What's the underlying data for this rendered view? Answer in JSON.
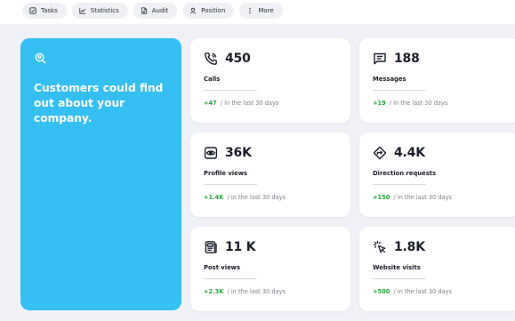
{
  "nav": {
    "tabs": [
      {
        "label": "Tasks",
        "icon": "checkbox-icon"
      },
      {
        "label": "Statistics",
        "icon": "chart-icon"
      },
      {
        "label": "Audit",
        "icon": "document-icon"
      },
      {
        "label": "Position",
        "icon": "location-user-icon"
      },
      {
        "label": "More",
        "icon": "more-vertical-icon"
      }
    ]
  },
  "hero": {
    "icon": "search-location-icon",
    "text": "Customers could find out about your company."
  },
  "period_text": "/ in the last 30 days",
  "cards": [
    {
      "icon": "phone-icon",
      "value": "450",
      "label": "Calls",
      "change": "+47"
    },
    {
      "icon": "message-icon",
      "value": "188",
      "label": "Messages",
      "change": "+19"
    },
    {
      "icon": "eye-icon",
      "value": "36K",
      "label": "Profile views",
      "change": "+1.4K"
    },
    {
      "icon": "direction-icon",
      "value": "4.4K",
      "label": "Direction requests",
      "change": "+150"
    },
    {
      "icon": "post-icon",
      "value": "11 K",
      "label": "Post views",
      "change": "+2.3K"
    },
    {
      "icon": "cursor-click-icon",
      "value": "1.8K",
      "label": "Website visits",
      "change": "+500"
    }
  ],
  "colors": {
    "accent": "#35bff2",
    "positive": "#22a63a",
    "background": "#f0f1f7"
  }
}
